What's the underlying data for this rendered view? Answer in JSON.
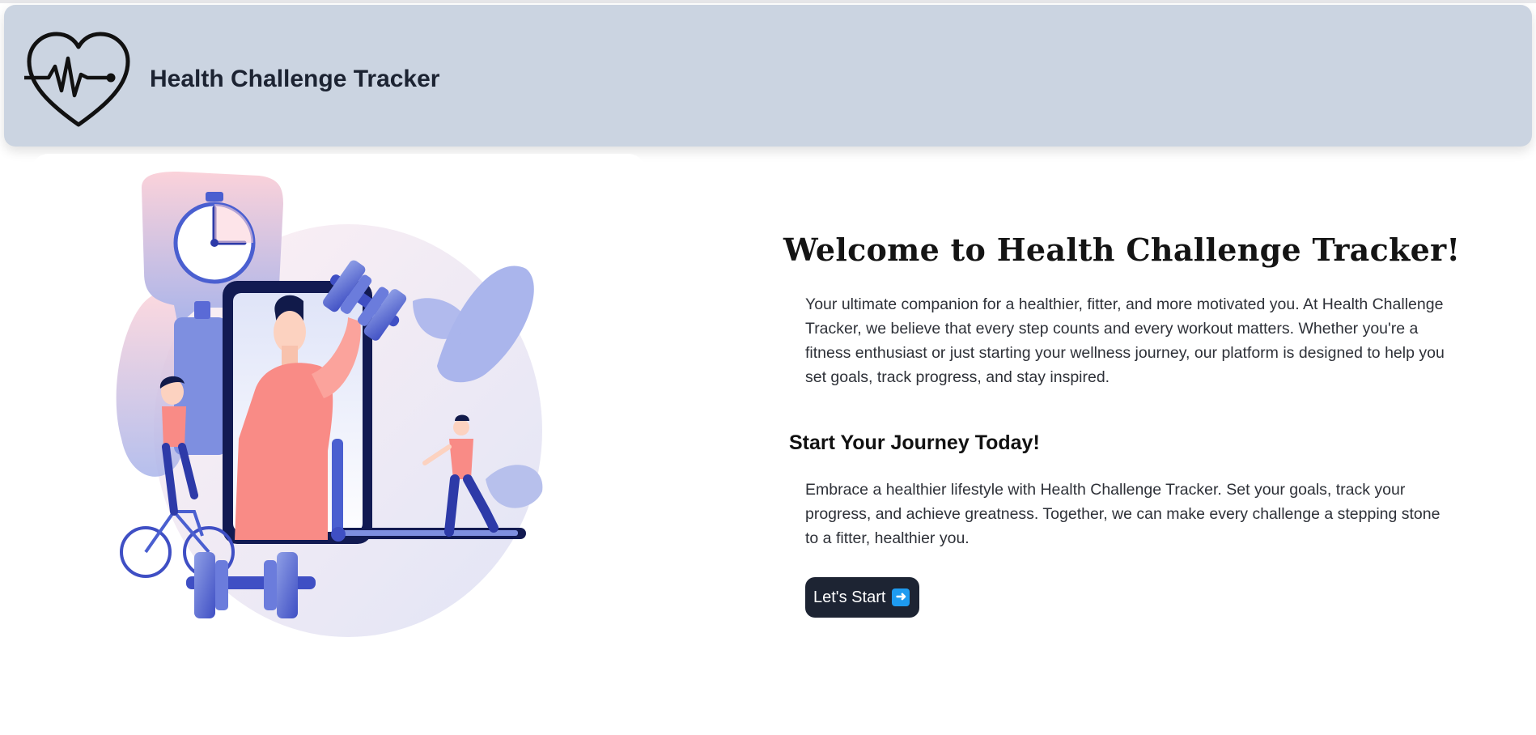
{
  "header": {
    "app_title": "Health Challenge Tracker",
    "logo_icon": "heart-pulse-icon"
  },
  "hero": {
    "illustration": "fitness-illustration"
  },
  "main": {
    "welcome_title": "Welcome to Health Challenge Tracker!",
    "intro_text": "Your ultimate companion for a healthier, fitter, and more motivated you. At Health Challenge Tracker, we believe that every step counts and every workout matters. Whether you're a fitness enthusiast or just starting your wellness journey, our platform is designed to help you set goals, track progress, and stay inspired.",
    "journey_title": "Start Your Journey Today!",
    "journey_text": "Embrace a healthier lifestyle with Health Challenge Tracker. Set your goals, track your progress, and achieve greatness. Together, we can make every challenge a stepping stone to a fitter, healthier you.",
    "start_button_label": "Let's Start",
    "start_button_icon": "right-arrow-icon"
  },
  "colors": {
    "header_bg": "#cbd4e1",
    "button_bg": "#1d2433",
    "accent_blue": "#4a5fd0",
    "accent_pink": "#f98b86"
  }
}
